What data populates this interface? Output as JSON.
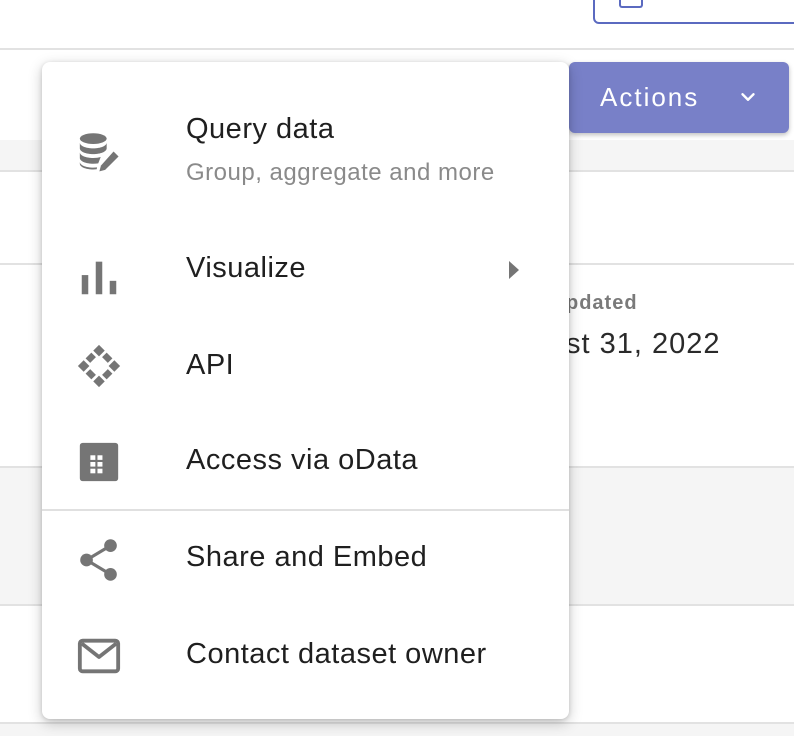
{
  "colors": {
    "accent": "#7880c8",
    "outline_accent": "#5b6ac0",
    "icon": "#757575",
    "text": "#1f1f1f",
    "secondary_text": "#8a8a8a"
  },
  "actions_button": {
    "label": "Actions",
    "icon": "chevron-down-icon"
  },
  "background": {
    "field_label": "pdated",
    "field_value": "st 31, 2022"
  },
  "menu": {
    "items": [
      {
        "label": "Query data",
        "sublabel": "Group, aggregate and more",
        "icon": "database-edit-icon"
      },
      {
        "label": "Visualize",
        "icon": "bar-chart-icon",
        "has_submenu": true
      },
      {
        "label": "API",
        "icon": "api-icon"
      },
      {
        "label": "Access via oData",
        "icon": "table-icon"
      },
      {
        "label": "Share and Embed",
        "icon": "share-icon"
      },
      {
        "label": "Contact dataset owner",
        "icon": "mail-icon"
      }
    ]
  }
}
